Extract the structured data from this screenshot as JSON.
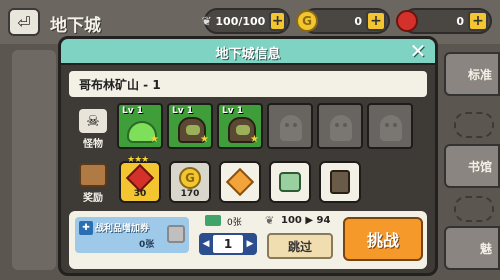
{
  "page": {
    "title": "地下城"
  },
  "resources": [
    {
      "name": "energy",
      "icon": "wing-icon",
      "value": "100/100"
    },
    {
      "name": "gold",
      "icon": "coin-icon",
      "value": "0"
    },
    {
      "name": "gem",
      "icon": "red-gem-icon",
      "value": "0"
    }
  ],
  "side_tabs": [
    "标准",
    "书馆",
    "魅"
  ],
  "dialog": {
    "title": "地下城信息",
    "stage_name": "哥布林矿山 - 1",
    "monster_label": "怪物",
    "reward_label": "奖励",
    "monsters": [
      {
        "level": "Lv 1",
        "kind": "slime",
        "active": true
      },
      {
        "level": "Lv 1",
        "kind": "goblin",
        "active": true
      },
      {
        "level": "Lv 1",
        "kind": "goblin",
        "active": true
      },
      {
        "level": "",
        "kind": "empty",
        "active": false
      },
      {
        "level": "",
        "kind": "empty",
        "active": false
      },
      {
        "level": "",
        "kind": "empty",
        "active": false
      }
    ],
    "rewards": [
      {
        "kind": "red-gem",
        "amount": "30",
        "stars": "★★★"
      },
      {
        "kind": "gold-coin",
        "amount": "170",
        "stars": ""
      },
      {
        "kind": "orange-cube",
        "amount": "",
        "stars": ""
      },
      {
        "kind": "thread-spool",
        "amount": "",
        "stars": ""
      },
      {
        "kind": "loot-box",
        "amount": "",
        "stars": ""
      }
    ],
    "coupon_label": "战利品增加券",
    "coupon_count": "0张",
    "ticket_count": "0张",
    "quantity": "1",
    "energy_cost": "100 ▶ 94",
    "skip_label": "跳过",
    "challenge_label": "挑战"
  },
  "colors": {
    "accent": "#7ed3c2",
    "challenge": "#f59a2a",
    "gold": "#f2c531"
  }
}
